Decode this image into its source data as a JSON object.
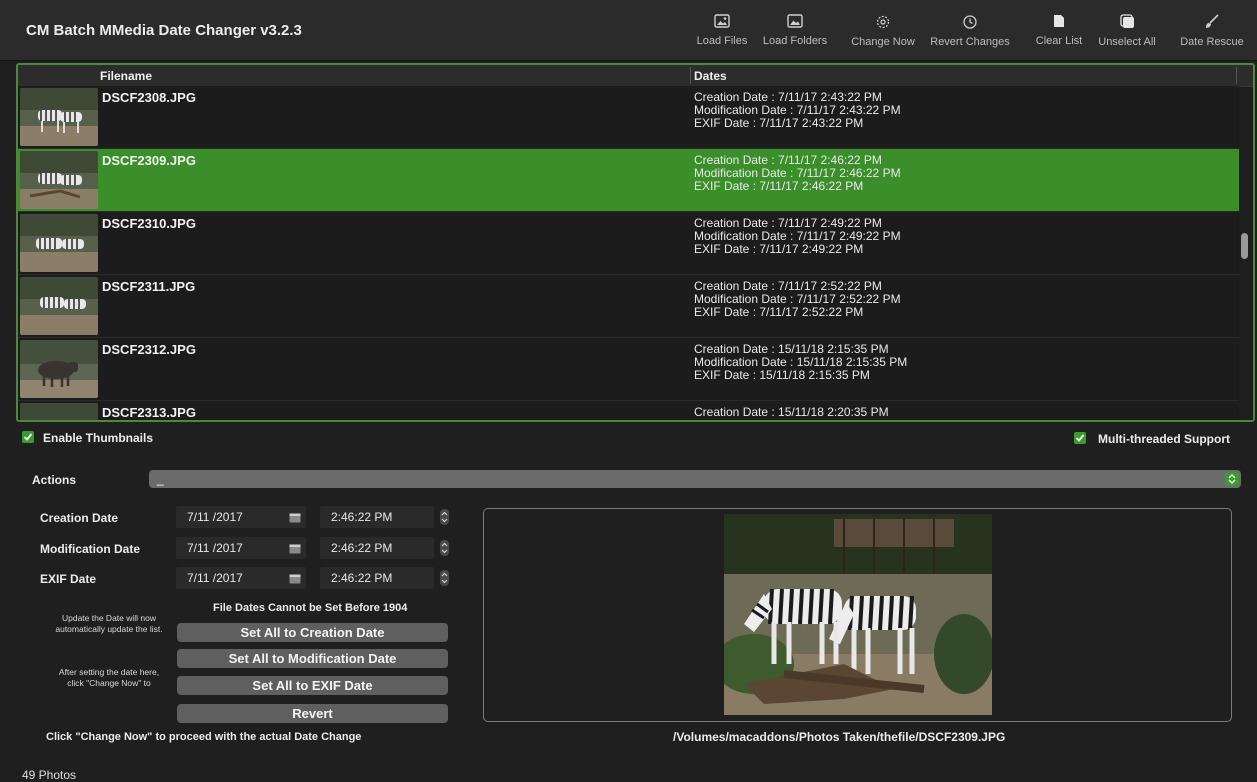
{
  "app": {
    "title": "CM Batch MMedia Date Changer v3.2.3"
  },
  "toolbar": {
    "load_files": "Load Files",
    "load_folders": "Load Folders",
    "change_now": "Change Now",
    "revert_changes": "Revert Changes",
    "clear_list": "Clear List",
    "unselect_all": "Unselect All",
    "date_rescue": "Date Rescue"
  },
  "list": {
    "columns": {
      "filename": "Filename",
      "dates": "Dates"
    },
    "rows": [
      {
        "filename": "DSCF2308.JPG",
        "creation": "Creation Date : 7/11/17 2:43:22 PM",
        "modification": "Modification Date : 7/11/17 2:43:22 PM",
        "exif": "EXIF Date : 7/11/17 2:43:22 PM"
      },
      {
        "filename": "DSCF2309.JPG",
        "creation": "Creation Date : 7/11/17 2:46:22 PM",
        "modification": "Modification Date : 7/11/17 2:46:22 PM",
        "exif": "EXIF Date : 7/11/17 2:46:22 PM"
      },
      {
        "filename": "DSCF2310.JPG",
        "creation": "Creation Date : 7/11/17 2:49:22 PM",
        "modification": "Modification Date : 7/11/17 2:49:22 PM",
        "exif": "EXIF Date : 7/11/17 2:49:22 PM"
      },
      {
        "filename": "DSCF2311.JPG",
        "creation": "Creation Date : 7/11/17 2:52:22 PM",
        "modification": "Modification Date : 7/11/17 2:52:22 PM",
        "exif": "EXIF Date : 7/11/17 2:52:22 PM"
      },
      {
        "filename": "DSCF2312.JPG",
        "creation": "Creation Date : 15/11/18 2:15:35 PM",
        "modification": "Modification Date : 15/11/18 2:15:35 PM",
        "exif": "EXIF Date : 15/11/18 2:15:35 PM"
      },
      {
        "filename": "DSCF2313.JPG",
        "creation": "Creation Date : 15/11/18 2:20:35 PM",
        "modification": "",
        "exif": ""
      }
    ],
    "selected_index": 1
  },
  "options": {
    "enable_thumbnails": "Enable Thumbnails",
    "multithreaded": "Multi-threaded Support"
  },
  "actions": {
    "label": "Actions",
    "value": "_"
  },
  "editor": {
    "creation_label": "Creation Date",
    "modification_label": "Modification Date",
    "exif_label": "EXIF Date",
    "creation_date": "7/11 /2017",
    "creation_time": "2:46:22  PM",
    "modification_date": "7/11 /2017",
    "modification_time": "2:46:22  PM",
    "exif_date": "7/11 /2017",
    "exif_time": "2:46:22  PM",
    "warning": "File Dates Cannot be Set Before 1904",
    "note_1": "Update the Date will now automatically update the list.",
    "note_2": "After setting the date here,  click \"Change Now\" to",
    "btn_all_creation": "Set All to Creation Date",
    "btn_all_modification": "Set All to Modification Date",
    "btn_all_exif": "Set All to EXIF Date",
    "btn_revert": "Revert",
    "footer_hint": "Click \"Change Now\" to proceed with the actual Date Change"
  },
  "preview": {
    "path": "/Volumes/macaddons/Photos Taken/thefile/DSCF2309.JPG"
  },
  "status": {
    "count": "49 Photos"
  },
  "colors": {
    "accent": "#3b8f2b",
    "border_green": "#4a8a3a"
  }
}
